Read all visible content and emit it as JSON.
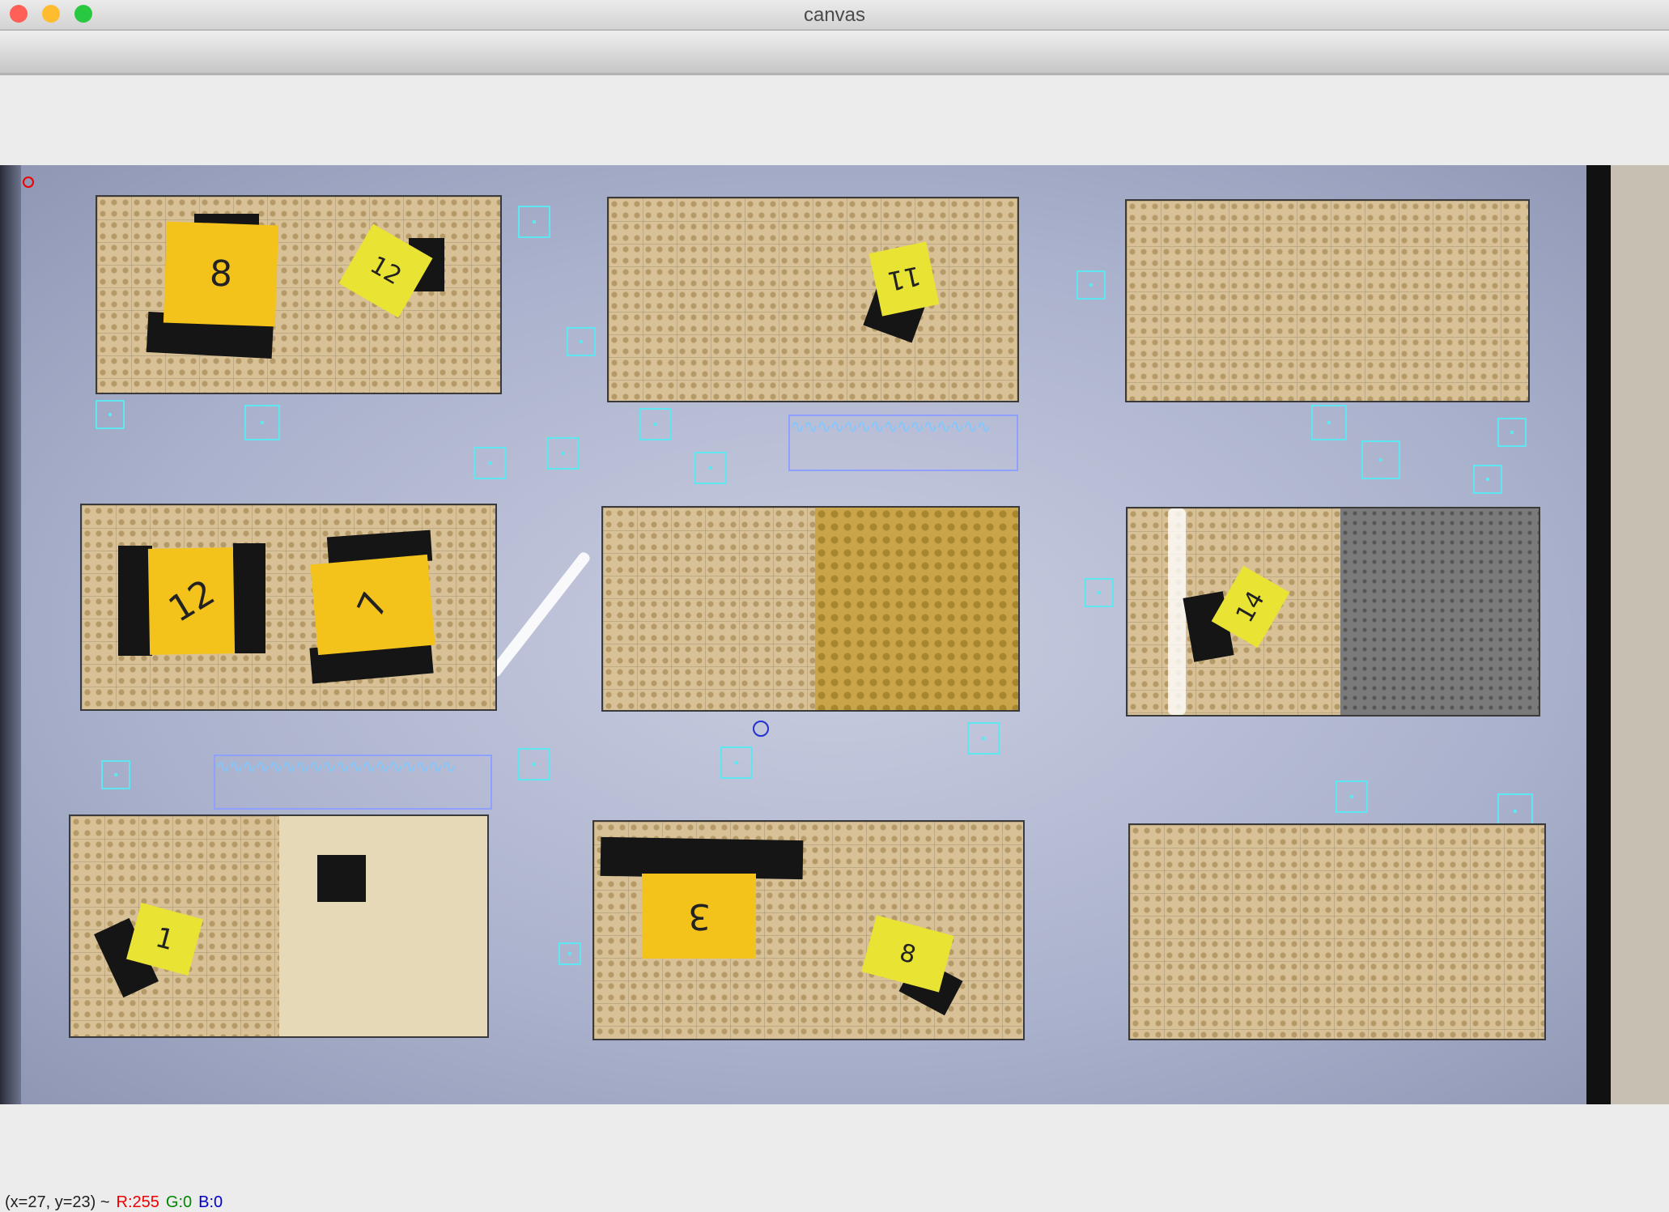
{
  "window": {
    "title": "canvas",
    "buttons": {
      "close_color": "#fe5f57",
      "minimize_color": "#febc2e",
      "maximize_color": "#28c840"
    }
  },
  "canvas": {
    "content": "camera view of LEGO city blocks on projected table",
    "lot_labels": [
      "8",
      "12",
      "11",
      "12",
      "7",
      "14",
      "1",
      "3",
      "8"
    ]
  },
  "status": {
    "coords": "(x=27, y=23) ~",
    "r": "R:255",
    "g": "G:0",
    "b": "B:0"
  }
}
